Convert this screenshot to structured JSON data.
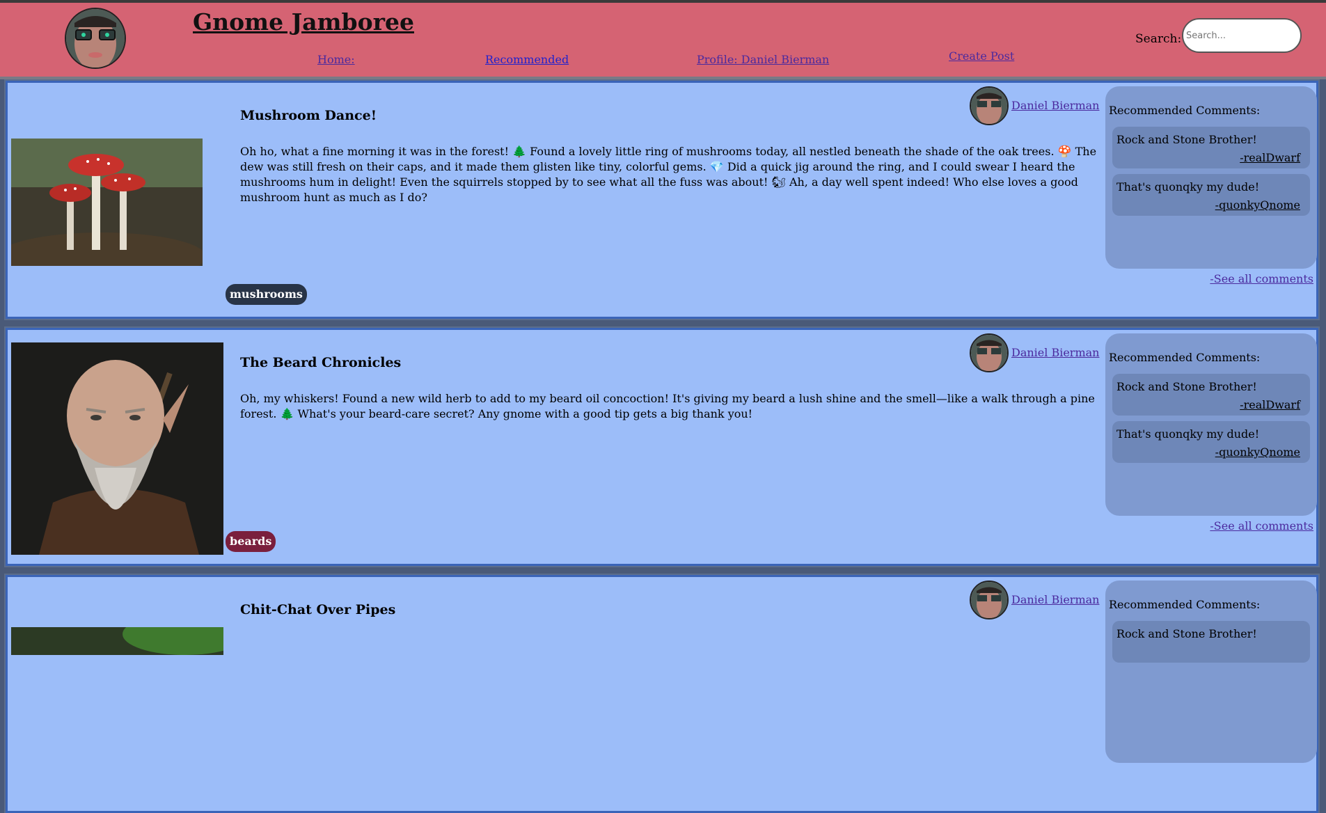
{
  "site": {
    "title": "Gnome Jamboree"
  },
  "nav": {
    "home": "Home:",
    "recommended": "Recommended",
    "profile": "Profile: Daniel Bierman",
    "create": "Create Post"
  },
  "search": {
    "label": "Search:",
    "placeholder": "Search..."
  },
  "comments_heading": "Recommended Comments:",
  "see_all_label": "-See all comments",
  "posts": [
    {
      "title": "Mushroom Dance!",
      "author": "Daniel Bierman",
      "body": "Oh ho, what a fine morning it was in the forest! 🌲 Found a lovely little ring of mushrooms today, all nestled beneath the shade of the oak trees. 🍄 The dew was still fresh on their caps, and it made them glisten like tiny, colorful gems. 💎 Did a quick jig around the ring, and I could swear I heard the mushrooms hum in delight! Even the squirrels stopped by to see what all the fuss was about! 🐿 Ah, a day well spent indeed! Who else loves a good mushroom hunt as much as I do?",
      "tag": "mushrooms",
      "tag_color": "#283447",
      "comments": [
        {
          "text": "Rock and Stone Brother!",
          "author": "-realDwarf"
        },
        {
          "text": "That's quonqky my dude!",
          "author": "-quonkyQnome"
        }
      ]
    },
    {
      "title": "The Beard Chronicles",
      "author": "Daniel Bierman",
      "body": "Oh, my whiskers! Found a new wild herb to add to my beard oil concoction! It's giving my beard a lush shine and the smell—like a walk through a pine forest. 🌲 What's your beard-care secret? Any gnome with a good tip gets a big thank you!",
      "tag": "beards",
      "tag_color": "#7a1f3d",
      "comments": [
        {
          "text": "Rock and Stone Brother!",
          "author": "-realDwarf"
        },
        {
          "text": "That's quonqky my dude!",
          "author": "-quonkyQnome"
        }
      ]
    },
    {
      "title": "Chit-Chat Over Pipes",
      "author": "Daniel Bierman",
      "comments": [
        {
          "text": "Rock and Stone Brother!"
        }
      ]
    }
  ]
}
